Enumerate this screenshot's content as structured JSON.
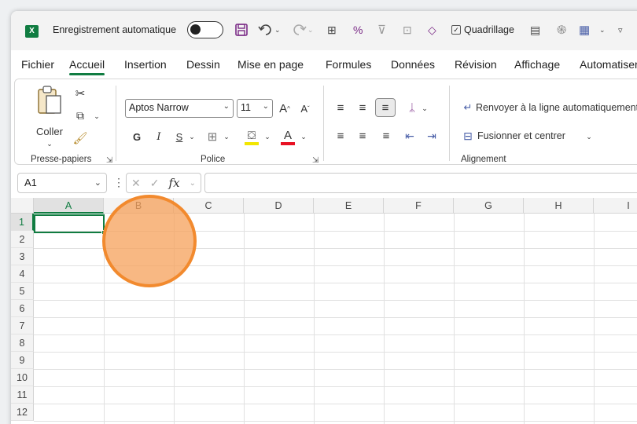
{
  "titlebar": {
    "app_logo": "X",
    "autosave_label": "Enregistrement automatique",
    "autosave_state": "off",
    "qat_icons": [
      "save-icon",
      "undo-icon",
      "redo-icon",
      "spelling-icon",
      "percent-icon",
      "filter-icon",
      "select-icon",
      "eraser-icon"
    ],
    "gridlines_label": "Quadrillage",
    "gridlines_checked": true
  },
  "tabs": [
    "Fichier",
    "Accueil",
    "Insertion",
    "Dessin",
    "Mise en page",
    "Formules",
    "Données",
    "Révision",
    "Affichage",
    "Automatiser"
  ],
  "active_tab": "Accueil",
  "ribbon": {
    "clipboard": {
      "paste_label": "Coller",
      "group_label": "Presse-papiers"
    },
    "font": {
      "font_name": "Aptos Narrow",
      "font_size": "11",
      "grow_label": "A",
      "shrink_label": "A",
      "bold": "G",
      "italic": "I",
      "underline": "S",
      "font_color_label": "A",
      "group_label": "Police"
    },
    "alignment": {
      "wrap_text_label": "Renvoyer à la ligne automatiquement",
      "merge_label": "Fusionner et centrer",
      "group_label": "Alignement"
    }
  },
  "formula_bar": {
    "name_box": "A1",
    "fx_label": "fx",
    "formula": ""
  },
  "sheet": {
    "columns": [
      "A",
      "B",
      "C",
      "D",
      "E",
      "F",
      "G",
      "H",
      "I"
    ],
    "rows": [
      "1",
      "2",
      "3",
      "4",
      "5",
      "6",
      "7",
      "8",
      "9",
      "10",
      "11",
      "12"
    ],
    "active_cell": "A1"
  },
  "colors": {
    "accent": "#107c41",
    "cursor_highlight": "#f28a2e",
    "save_icon": "#7a2a86"
  }
}
